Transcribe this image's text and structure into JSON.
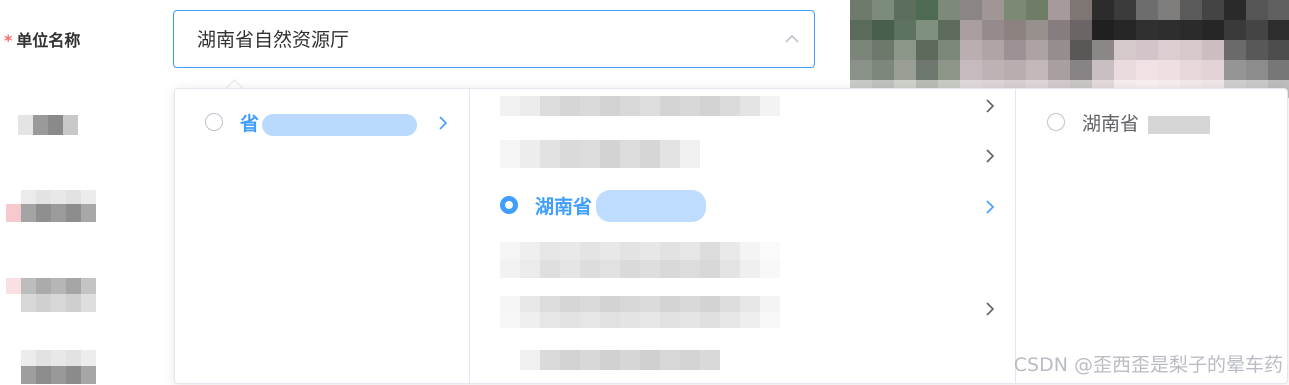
{
  "form": {
    "required_mark": "*",
    "label": "单位名称",
    "selected_value": "湖南省自然资源厅"
  },
  "cascader": {
    "column1": {
      "visible_text": "省"
    },
    "column2": {
      "visible_text": "湖南省"
    },
    "column3": {
      "visible_text": "湖南省"
    }
  },
  "watermark": "CSDN @歪西歪是梨子的晕车药",
  "colors": {
    "accent": "#409eff",
    "required": "#f56c6c",
    "text": "#303133",
    "muted_text": "#606266",
    "border": "#e4e7ed"
  },
  "icons": {
    "input_arrow": "chevron-up-icon",
    "expand": "chevron-right-icon"
  }
}
